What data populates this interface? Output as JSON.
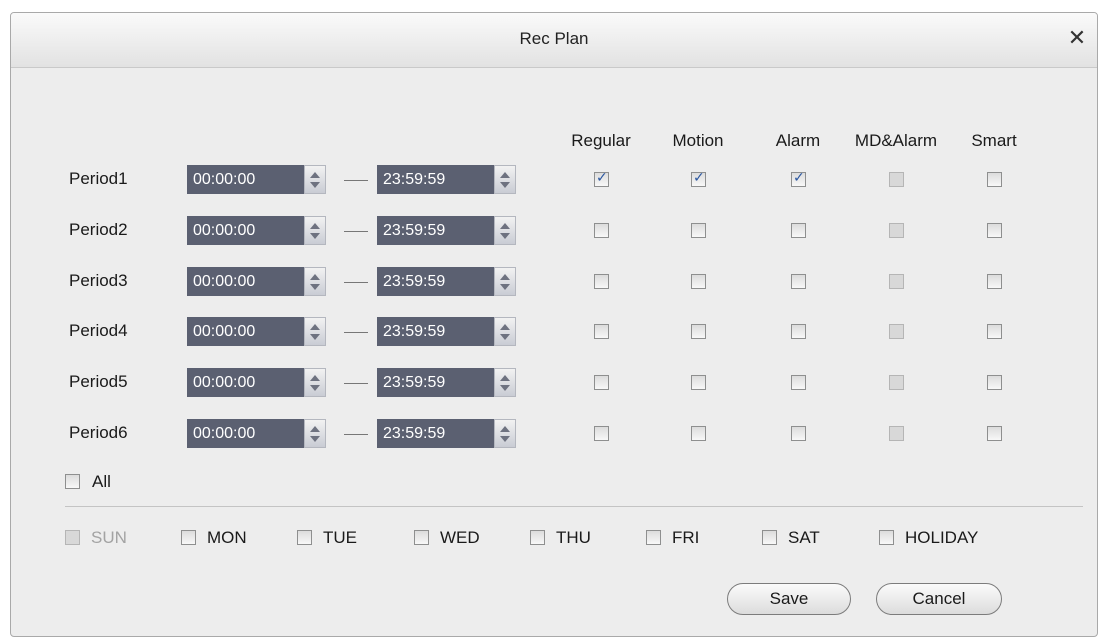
{
  "dialog": {
    "title": "Rec Plan",
    "close_icon": "close-icon"
  },
  "columns": [
    "Regular",
    "Motion",
    "Alarm",
    "MD&Alarm",
    "Smart"
  ],
  "periods": [
    {
      "label": "Period1",
      "start": "00:00:00",
      "end": "23:59:59",
      "checks": [
        true,
        true,
        true,
        false,
        false
      ]
    },
    {
      "label": "Period2",
      "start": "00:00:00",
      "end": "23:59:59",
      "checks": [
        false,
        false,
        false,
        false,
        false
      ]
    },
    {
      "label": "Period3",
      "start": "00:00:00",
      "end": "23:59:59",
      "checks": [
        false,
        false,
        false,
        false,
        false
      ]
    },
    {
      "label": "Period4",
      "start": "00:00:00",
      "end": "23:59:59",
      "checks": [
        false,
        false,
        false,
        false,
        false
      ]
    },
    {
      "label": "Period5",
      "start": "00:00:00",
      "end": "23:59:59",
      "checks": [
        false,
        false,
        false,
        false,
        false
      ]
    },
    {
      "label": "Period6",
      "start": "00:00:00",
      "end": "23:59:59",
      "checks": [
        false,
        false,
        false,
        false,
        false
      ]
    }
  ],
  "all": {
    "label": "All",
    "checked": false
  },
  "days": [
    {
      "label": "SUN",
      "checked": false,
      "disabled": true
    },
    {
      "label": "MON",
      "checked": false,
      "disabled": false
    },
    {
      "label": "TUE",
      "checked": false,
      "disabled": false
    },
    {
      "label": "WED",
      "checked": false,
      "disabled": false
    },
    {
      "label": "THU",
      "checked": false,
      "disabled": false
    },
    {
      "label": "FRI",
      "checked": false,
      "disabled": false
    },
    {
      "label": "SAT",
      "checked": false,
      "disabled": false
    },
    {
      "label": "HOLIDAY",
      "checked": false,
      "disabled": false
    }
  ],
  "buttons": {
    "save": "Save",
    "cancel": "Cancel"
  },
  "colors": {
    "time_field_bg": "#5b6071",
    "check_mark": "#2a56a0",
    "dialog_bg": "#ededed"
  }
}
